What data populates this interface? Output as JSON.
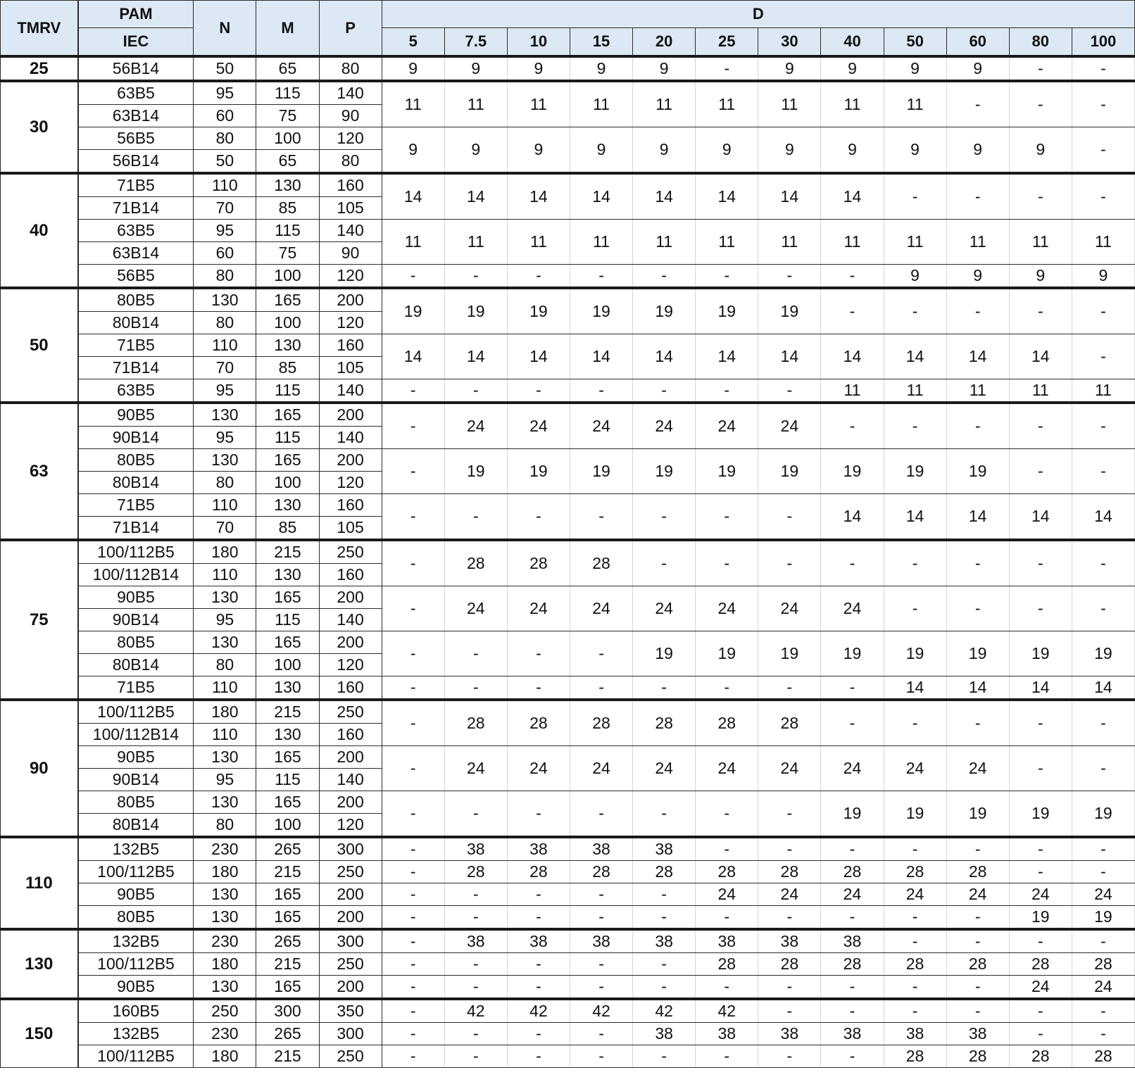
{
  "headers": {
    "tmrv": "TMRV",
    "pam": "PAM",
    "iec": "IEC",
    "n": "N",
    "m": "M",
    "p": "P",
    "d": "D",
    "ratios": [
      "5",
      "7.5",
      "10",
      "15",
      "20",
      "25",
      "30",
      "40",
      "50",
      "60",
      "80",
      "100"
    ]
  },
  "groups": [
    {
      "tmrv": "25",
      "rows": [
        {
          "iec": "56B14",
          "n": "50",
          "m": "65",
          "p": "80"
        }
      ],
      "blocks": [
        {
          "span": 1,
          "d": [
            "9",
            "9",
            "9",
            "9",
            "9",
            "-",
            "9",
            "9",
            "9",
            "9",
            "-",
            "-"
          ]
        }
      ]
    },
    {
      "tmrv": "30",
      "rows": [
        {
          "iec": "63B5",
          "n": "95",
          "m": "115",
          "p": "140"
        },
        {
          "iec": "63B14",
          "n": "60",
          "m": "75",
          "p": "90"
        },
        {
          "iec": "56B5",
          "n": "80",
          "m": "100",
          "p": "120"
        },
        {
          "iec": "56B14",
          "n": "50",
          "m": "65",
          "p": "80"
        }
      ],
      "blocks": [
        {
          "span": 2,
          "d": [
            "11",
            "11",
            "11",
            "11",
            "11",
            "11",
            "11",
            "11",
            "11",
            "-",
            "-",
            "-"
          ]
        },
        {
          "span": 2,
          "d": [
            "9",
            "9",
            "9",
            "9",
            "9",
            "9",
            "9",
            "9",
            "9",
            "9",
            "9",
            "-"
          ]
        }
      ]
    },
    {
      "tmrv": "40",
      "rows": [
        {
          "iec": "71B5",
          "n": "110",
          "m": "130",
          "p": "160"
        },
        {
          "iec": "71B14",
          "n": "70",
          "m": "85",
          "p": "105"
        },
        {
          "iec": "63B5",
          "n": "95",
          "m": "115",
          "p": "140"
        },
        {
          "iec": "63B14",
          "n": "60",
          "m": "75",
          "p": "90"
        },
        {
          "iec": "56B5",
          "n": "80",
          "m": "100",
          "p": "120"
        }
      ],
      "blocks": [
        {
          "span": 2,
          "d": [
            "14",
            "14",
            "14",
            "14",
            "14",
            "14",
            "14",
            "14",
            "-",
            "-",
            "-",
            "-"
          ]
        },
        {
          "span": 2,
          "d": [
            "11",
            "11",
            "11",
            "11",
            "11",
            "11",
            "11",
            "11",
            "11",
            "11",
            "11",
            "11"
          ]
        },
        {
          "span": 1,
          "d": [
            "-",
            "-",
            "-",
            "-",
            "-",
            "-",
            "-",
            "-",
            "9",
            "9",
            "9",
            "9"
          ]
        }
      ]
    },
    {
      "tmrv": "50",
      "rows": [
        {
          "iec": "80B5",
          "n": "130",
          "m": "165",
          "p": "200"
        },
        {
          "iec": "80B14",
          "n": "80",
          "m": "100",
          "p": "120"
        },
        {
          "iec": "71B5",
          "n": "110",
          "m": "130",
          "p": "160"
        },
        {
          "iec": "71B14",
          "n": "70",
          "m": "85",
          "p": "105"
        },
        {
          "iec": "63B5",
          "n": "95",
          "m": "115",
          "p": "140"
        }
      ],
      "blocks": [
        {
          "span": 2,
          "d": [
            "19",
            "19",
            "19",
            "19",
            "19",
            "19",
            "19",
            "-",
            "-",
            "-",
            "-",
            "-"
          ]
        },
        {
          "span": 2,
          "d": [
            "14",
            "14",
            "14",
            "14",
            "14",
            "14",
            "14",
            "14",
            "14",
            "14",
            "14",
            "-"
          ]
        },
        {
          "span": 1,
          "d": [
            "-",
            "-",
            "-",
            "-",
            "-",
            "-",
            "-",
            "11",
            "11",
            "11",
            "11",
            "11"
          ]
        }
      ]
    },
    {
      "tmrv": "63",
      "rows": [
        {
          "iec": "90B5",
          "n": "130",
          "m": "165",
          "p": "200"
        },
        {
          "iec": "90B14",
          "n": "95",
          "m": "115",
          "p": "140"
        },
        {
          "iec": "80B5",
          "n": "130",
          "m": "165",
          "p": "200"
        },
        {
          "iec": "80B14",
          "n": "80",
          "m": "100",
          "p": "120"
        },
        {
          "iec": "71B5",
          "n": "110",
          "m": "130",
          "p": "160"
        },
        {
          "iec": "71B14",
          "n": "70",
          "m": "85",
          "p": "105"
        }
      ],
      "blocks": [
        {
          "span": 2,
          "d": [
            "-",
            "24",
            "24",
            "24",
            "24",
            "24",
            "24",
            "-",
            "-",
            "-",
            "-",
            "-"
          ]
        },
        {
          "span": 2,
          "d": [
            "-",
            "19",
            "19",
            "19",
            "19",
            "19",
            "19",
            "19",
            "19",
            "19",
            "-",
            "-"
          ]
        },
        {
          "span": 2,
          "d": [
            "-",
            "-",
            "-",
            "-",
            "-",
            "-",
            "-",
            "14",
            "14",
            "14",
            "14",
            "14"
          ]
        }
      ]
    },
    {
      "tmrv": "75",
      "rows": [
        {
          "iec": "100/112B5",
          "n": "180",
          "m": "215",
          "p": "250"
        },
        {
          "iec": "100/112B14",
          "n": "110",
          "m": "130",
          "p": "160"
        },
        {
          "iec": "90B5",
          "n": "130",
          "m": "165",
          "p": "200"
        },
        {
          "iec": "90B14",
          "n": "95",
          "m": "115",
          "p": "140"
        },
        {
          "iec": "80B5",
          "n": "130",
          "m": "165",
          "p": "200"
        },
        {
          "iec": "80B14",
          "n": "80",
          "m": "100",
          "p": "120"
        },
        {
          "iec": "71B5",
          "n": "110",
          "m": "130",
          "p": "160"
        }
      ],
      "blocks": [
        {
          "span": 2,
          "d": [
            "-",
            "28",
            "28",
            "28",
            "-",
            "-",
            "-",
            "-",
            "-",
            "-",
            "-",
            "-"
          ]
        },
        {
          "span": 2,
          "d": [
            "-",
            "24",
            "24",
            "24",
            "24",
            "24",
            "24",
            "24",
            "-",
            "-",
            "-",
            "-"
          ]
        },
        {
          "span": 2,
          "d": [
            "-",
            "-",
            "-",
            "-",
            "19",
            "19",
            "19",
            "19",
            "19",
            "19",
            "19",
            "19"
          ]
        },
        {
          "span": 1,
          "d": [
            "-",
            "-",
            "-",
            "-",
            "-",
            "-",
            "-",
            "-",
            "14",
            "14",
            "14",
            "14"
          ]
        }
      ]
    },
    {
      "tmrv": "90",
      "rows": [
        {
          "iec": "100/112B5",
          "n": "180",
          "m": "215",
          "p": "250"
        },
        {
          "iec": "100/112B14",
          "n": "110",
          "m": "130",
          "p": "160"
        },
        {
          "iec": "90B5",
          "n": "130",
          "m": "165",
          "p": "200"
        },
        {
          "iec": "90B14",
          "n": "95",
          "m": "115",
          "p": "140"
        },
        {
          "iec": "80B5",
          "n": "130",
          "m": "165",
          "p": "200"
        },
        {
          "iec": "80B14",
          "n": "80",
          "m": "100",
          "p": "120"
        }
      ],
      "blocks": [
        {
          "span": 2,
          "d": [
            "-",
            "28",
            "28",
            "28",
            "28",
            "28",
            "28",
            "-",
            "-",
            "-",
            "-",
            "-"
          ]
        },
        {
          "span": 2,
          "d": [
            "-",
            "24",
            "24",
            "24",
            "24",
            "24",
            "24",
            "24",
            "24",
            "24",
            "-",
            "-"
          ]
        },
        {
          "span": 2,
          "d": [
            "-",
            "-",
            "-",
            "-",
            "-",
            "-",
            "-",
            "19",
            "19",
            "19",
            "19",
            "19"
          ]
        }
      ]
    },
    {
      "tmrv": "110",
      "rows": [
        {
          "iec": "132B5",
          "n": "230",
          "m": "265",
          "p": "300"
        },
        {
          "iec": "100/112B5",
          "n": "180",
          "m": "215",
          "p": "250"
        },
        {
          "iec": "90B5",
          "n": "130",
          "m": "165",
          "p": "200"
        },
        {
          "iec": "80B5",
          "n": "130",
          "m": "165",
          "p": "200"
        }
      ],
      "blocks": [
        {
          "span": 1,
          "d": [
            "-",
            "38",
            "38",
            "38",
            "38",
            "-",
            "-",
            "-",
            "-",
            "-",
            "-",
            "-"
          ]
        },
        {
          "span": 1,
          "d": [
            "-",
            "28",
            "28",
            "28",
            "28",
            "28",
            "28",
            "28",
            "28",
            "28",
            "-",
            "-"
          ]
        },
        {
          "span": 1,
          "d": [
            "-",
            "-",
            "-",
            "-",
            "-",
            "24",
            "24",
            "24",
            "24",
            "24",
            "24",
            "24"
          ]
        },
        {
          "span": 1,
          "d": [
            "-",
            "-",
            "-",
            "-",
            "-",
            "-",
            "-",
            "-",
            "-",
            "-",
            "19",
            "19"
          ]
        }
      ]
    },
    {
      "tmrv": "130",
      "rows": [
        {
          "iec": "132B5",
          "n": "230",
          "m": "265",
          "p": "300"
        },
        {
          "iec": "100/112B5",
          "n": "180",
          "m": "215",
          "p": "250"
        },
        {
          "iec": "90B5",
          "n": "130",
          "m": "165",
          "p": "200"
        }
      ],
      "blocks": [
        {
          "span": 1,
          "d": [
            "-",
            "38",
            "38",
            "38",
            "38",
            "38",
            "38",
            "38",
            "-",
            "-",
            "-",
            "-"
          ]
        },
        {
          "span": 1,
          "d": [
            "-",
            "-",
            "-",
            "-",
            "-",
            "28",
            "28",
            "28",
            "28",
            "28",
            "28",
            "28"
          ]
        },
        {
          "span": 1,
          "d": [
            "-",
            "-",
            "-",
            "-",
            "-",
            "-",
            "-",
            "-",
            "-",
            "-",
            "24",
            "24"
          ]
        }
      ]
    },
    {
      "tmrv": "150",
      "rows": [
        {
          "iec": "160B5",
          "n": "250",
          "m": "300",
          "p": "350"
        },
        {
          "iec": "132B5",
          "n": "230",
          "m": "265",
          "p": "300"
        },
        {
          "iec": "100/112B5",
          "n": "180",
          "m": "215",
          "p": "250"
        }
      ],
      "blocks": [
        {
          "span": 1,
          "d": [
            "-",
            "42",
            "42",
            "42",
            "42",
            "42",
            "-",
            "-",
            "-",
            "-",
            "-",
            "-"
          ]
        },
        {
          "span": 1,
          "d": [
            "-",
            "-",
            "-",
            "-",
            "38",
            "38",
            "38",
            "38",
            "38",
            "38",
            "-",
            "-"
          ]
        },
        {
          "span": 1,
          "d": [
            "-",
            "-",
            "-",
            "-",
            "-",
            "-",
            "-",
            "-",
            "28",
            "28",
            "28",
            "28"
          ]
        }
      ]
    }
  ]
}
